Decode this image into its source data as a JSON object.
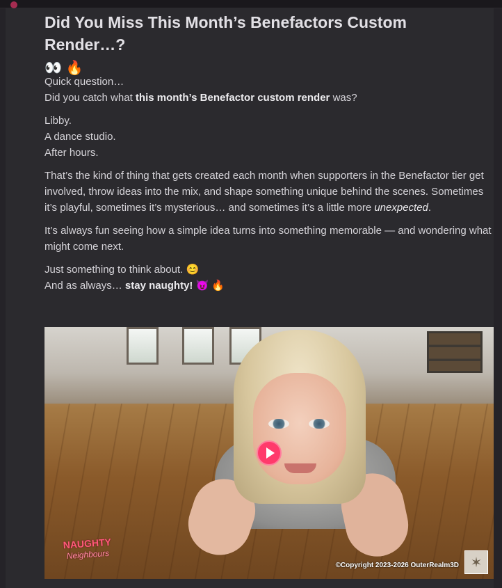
{
  "post": {
    "title": "Did You Miss This Month’s Benefactors Custom Render…?",
    "title_emojis": "👀 🔥",
    "p1_line1": "Quick question…",
    "p1_line2_a": "Did you catch what ",
    "p1_line2_b": "this month’s Benefactor custom render",
    "p1_line2_c": " was?",
    "p2_line1": "Libby.",
    "p2_line2": "A dance studio.",
    "p2_line3": "After hours.",
    "p3_a": "That’s the kind of thing that gets created each month when supporters in the Benefactor tier get involved, throw ideas into the mix, and shape something unique behind the scenes. Sometimes it’s playful, sometimes it’s mysterious… and sometimes it’s a little more ",
    "p3_b": "unexpected",
    "p3_c": ".",
    "p4": "It’s always fun seeing how a simple idea turns into something memorable — and wondering what might come next.",
    "p5_line1_text": "Just something to think about.",
    "p5_line1_emoji": "😊",
    "p5_line2_a": "And as always… ",
    "p5_line2_b": "stay naughty!",
    "p5_line2_emoji": "😈 🔥"
  },
  "media": {
    "logo_line1": "NAUGHTY",
    "logo_line2": "Neighbours",
    "copyright": "©Copyright 2023-2026 OuterRealm3D",
    "play_icon": "play-icon",
    "accent": "#ff3a6b"
  }
}
